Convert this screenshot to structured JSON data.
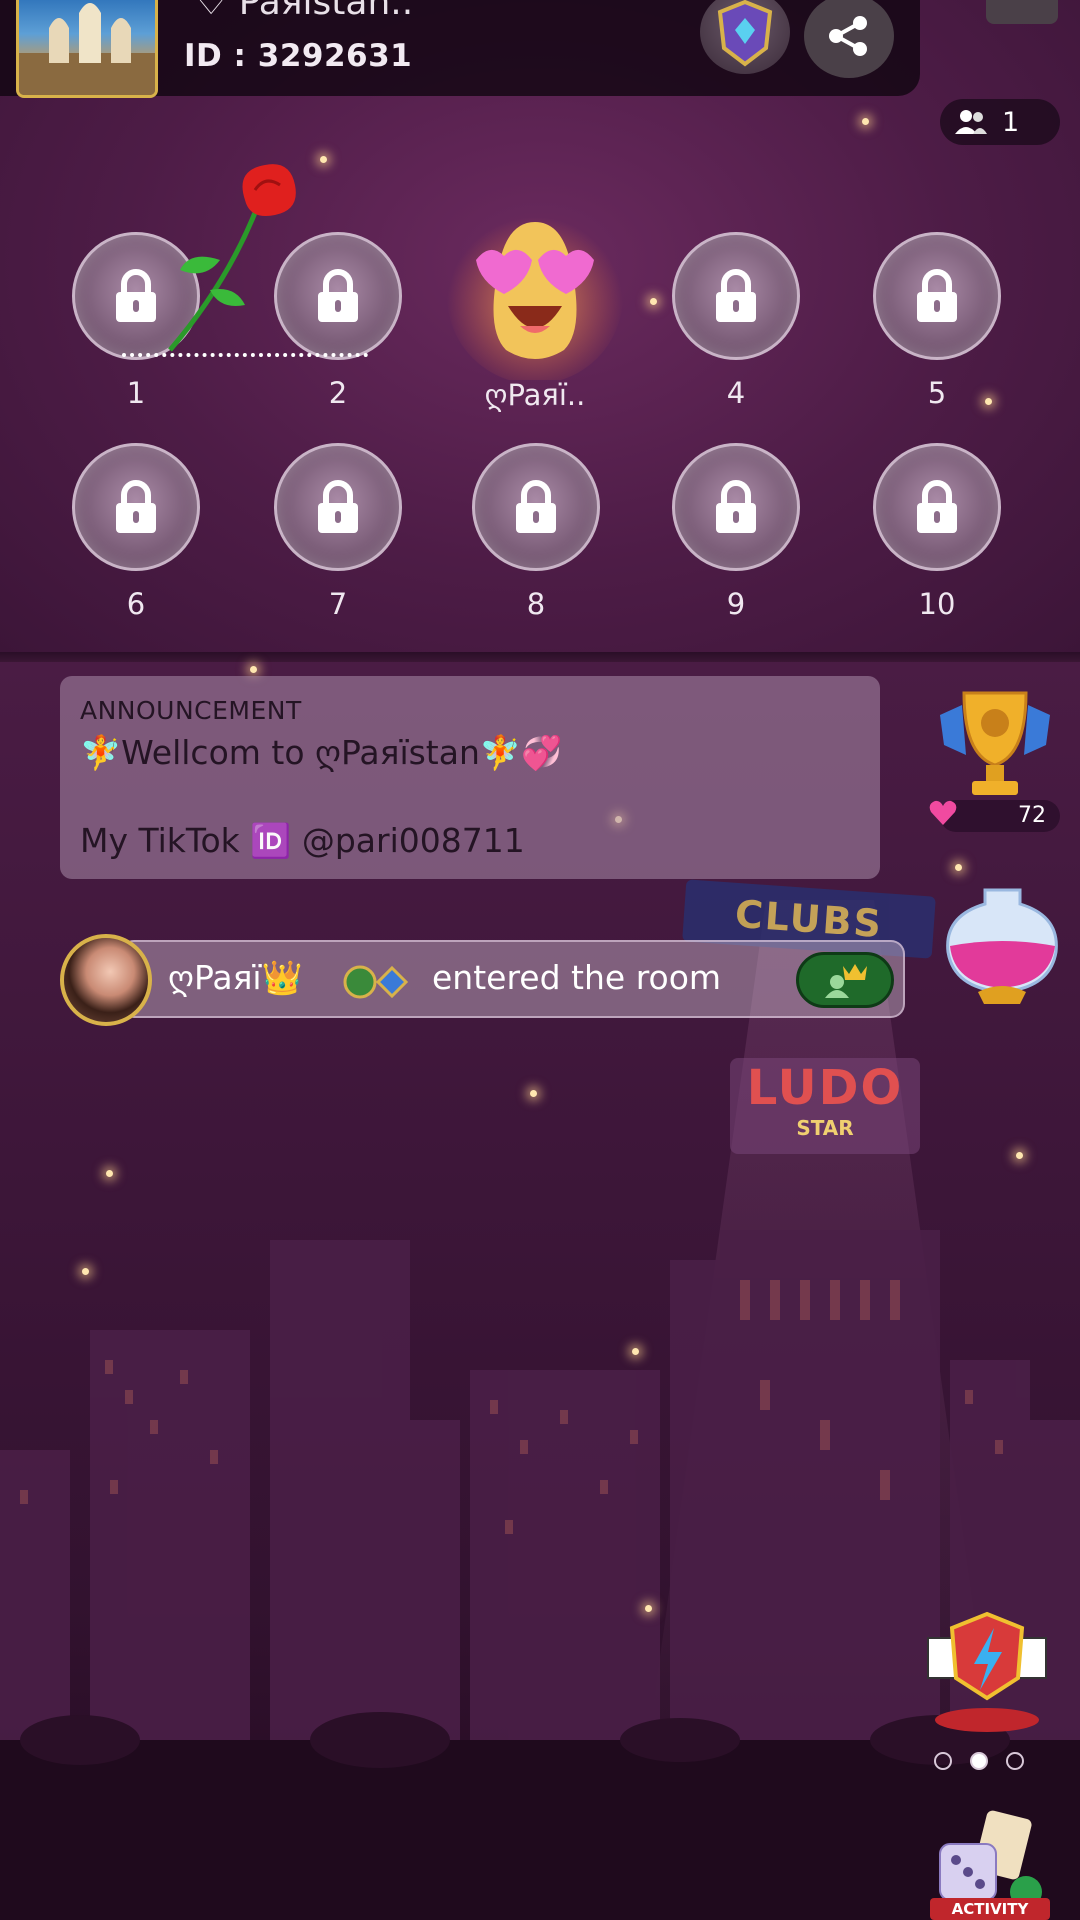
{
  "header": {
    "room_name": "♡ Paяïstan..",
    "room_id": "ID : 3292631",
    "online_count": "1"
  },
  "seats": [
    {
      "number": "1",
      "state": "locked"
    },
    {
      "number": "2",
      "state": "locked"
    },
    {
      "number": "3",
      "state": "occupied",
      "occupant_name": "ღPaяï.."
    },
    {
      "number": "4",
      "state": "locked"
    },
    {
      "number": "5",
      "state": "locked"
    },
    {
      "number": "6",
      "state": "locked"
    },
    {
      "number": "7",
      "state": "locked"
    },
    {
      "number": "8",
      "state": "locked"
    },
    {
      "number": "9",
      "state": "locked"
    },
    {
      "number": "10",
      "state": "locked"
    }
  ],
  "announcement": {
    "title": "ANNOUNCEMENT",
    "line1": "🧚Wellcom to ღPaяïstan🧚💞",
    "line2": "My TikTok 🆔 @pari008711"
  },
  "trophy": {
    "score": "72"
  },
  "clubs": {
    "label": "CLUBS"
  },
  "ludo_sign": {
    "word": "LUDO",
    "sub": "STAR"
  },
  "join_message": {
    "user": "ღPaяï👑",
    "text": "entered the room"
  },
  "activity": {
    "label": "ACTIVITY"
  },
  "pager": {
    "active_index": 1,
    "count": 3
  },
  "colors": {
    "gold": "#d8b24a",
    "follow_green": "#1f6a2a",
    "activity_red": "#c0262c"
  }
}
